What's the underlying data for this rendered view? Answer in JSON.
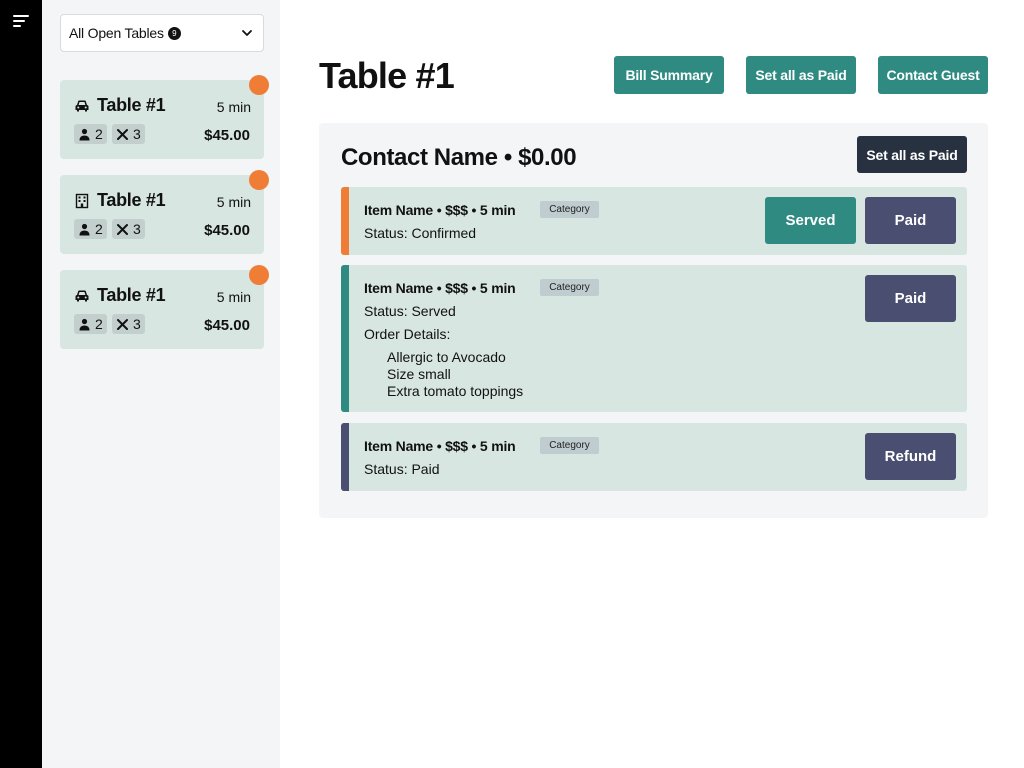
{
  "sidebar": {
    "filter": {
      "label": "All Open Tables",
      "count": "9"
    },
    "tables": [
      {
        "icon": "car-icon",
        "title": "Table #1",
        "time": "5 min",
        "guests": "2",
        "items": "3",
        "price": "$45.00"
      },
      {
        "icon": "building-icon",
        "title": "Table #1",
        "time": "5 min",
        "guests": "2",
        "items": "3",
        "price": "$45.00"
      },
      {
        "icon": "car-icon",
        "title": "Table #1",
        "time": "5 min",
        "guests": "2",
        "items": "3",
        "price": "$45.00"
      }
    ]
  },
  "header": {
    "title": "Table #1",
    "actions": {
      "bill_summary": "Bill Summary",
      "set_all_paid": "Set all as Paid",
      "contact_guest": "Contact Guest"
    }
  },
  "contact": {
    "title": "Contact Name • $0.00",
    "set_all_paid": "Set all as Paid",
    "items": [
      {
        "name": "Item Name • $$$ • 5 min",
        "category": "Category",
        "status": "Status: Confirmed",
        "buttons": [
          "Served",
          "Paid"
        ]
      },
      {
        "name": "Item Name • $$$ • 5 min",
        "category": "Category",
        "status": "Status: Served",
        "details_label": "Order Details:",
        "details": [
          "Allergic to Avocado",
          "Size small",
          "Extra tomato toppings"
        ],
        "buttons": [
          "Paid"
        ]
      },
      {
        "name": "Item Name • $$$ • 5 min",
        "category": "Category",
        "status": "Status: Paid",
        "buttons": [
          "Refund"
        ]
      }
    ]
  },
  "colors": {
    "teal": "#2f8b82",
    "dark": "#283140",
    "slate": "#4a4e70",
    "orange": "#f07d36",
    "card_bg": "#d8e6e2"
  }
}
